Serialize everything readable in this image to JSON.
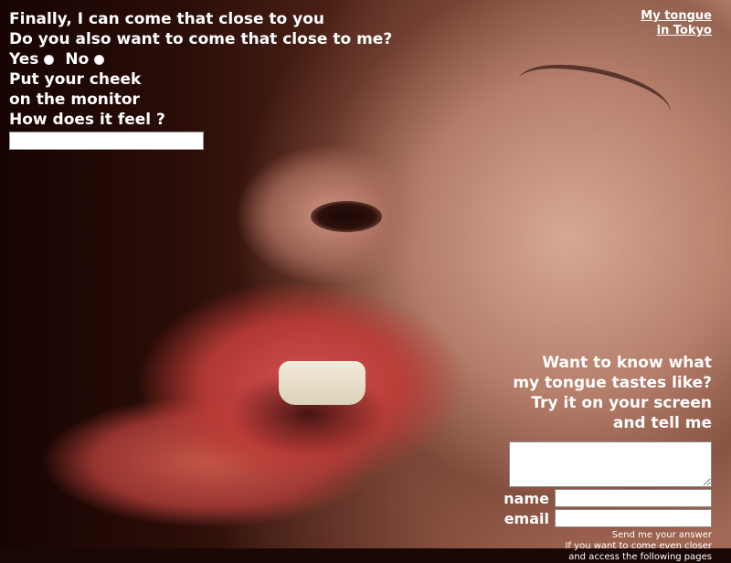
{
  "intro": {
    "line1": "Finally, I can come that close to you",
    "line2": "Do you also want to come that close to me?",
    "yes_label": "Yes",
    "no_label": "No",
    "line3": "Put your cheek",
    "line4": "on the monitor",
    "line5": "How does it feel ?",
    "feel_value": ""
  },
  "top_link": {
    "line1": "My tongue",
    "line2": "in Tokyo"
  },
  "taste": {
    "line1": "Want to know what",
    "line2": "my tongue tastes like?",
    "line3": "Try it on your screen",
    "line4": "and tell me",
    "answer_value": "",
    "name_label": "name",
    "name_value": "",
    "email_label": "email",
    "email_value": "",
    "note_line1": "Send me your answer",
    "note_line2": "If you want to come even closer",
    "note_line3": "and access the following pages"
  },
  "colors": {
    "text": "#ffffff",
    "background": "#1a0806"
  }
}
